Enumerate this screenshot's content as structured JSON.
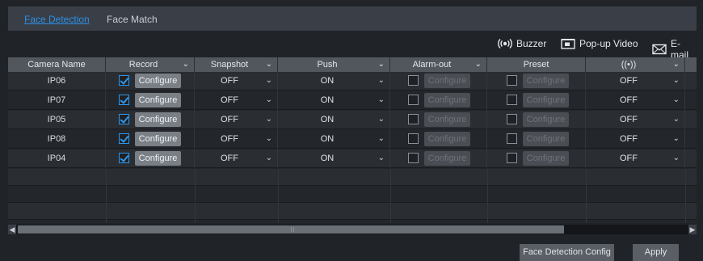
{
  "tabs": [
    {
      "label": "Face Detection",
      "active": true
    },
    {
      "label": "Face Match",
      "active": false
    }
  ],
  "toolbar": {
    "buzzer_label": "Buzzer",
    "popup_label": "Pop-up Video",
    "email_label": "E-mail"
  },
  "columns": {
    "camera": "Camera Name",
    "record": "Record",
    "snapshot": "Snapshot",
    "push": "Push",
    "alarm_out": "Alarm-out",
    "preset": "Preset",
    "buzzer_icon": "((•))"
  },
  "configure_label": "Configure",
  "rows": [
    {
      "camera": "IP06",
      "record_checked": true,
      "snapshot": "OFF",
      "push": "ON",
      "alarm_checked": false,
      "preset_checked": false,
      "buzzer": "OFF"
    },
    {
      "camera": "IP07",
      "record_checked": true,
      "snapshot": "OFF",
      "push": "ON",
      "alarm_checked": false,
      "preset_checked": false,
      "buzzer": "OFF"
    },
    {
      "camera": "IP05",
      "record_checked": true,
      "snapshot": "OFF",
      "push": "ON",
      "alarm_checked": false,
      "preset_checked": false,
      "buzzer": "OFF"
    },
    {
      "camera": "IP08",
      "record_checked": true,
      "snapshot": "OFF",
      "push": "ON",
      "alarm_checked": false,
      "preset_checked": false,
      "buzzer": "OFF"
    },
    {
      "camera": "IP04",
      "record_checked": true,
      "snapshot": "OFF",
      "push": "ON",
      "alarm_checked": false,
      "preset_checked": false,
      "buzzer": "OFF"
    }
  ],
  "buttons": {
    "face_detection_config": "Face Detection Config",
    "apply": "Apply"
  },
  "colors": {
    "accent": "#2b8fe6",
    "header_bg": "#52575e",
    "page_bg": "#202328"
  }
}
